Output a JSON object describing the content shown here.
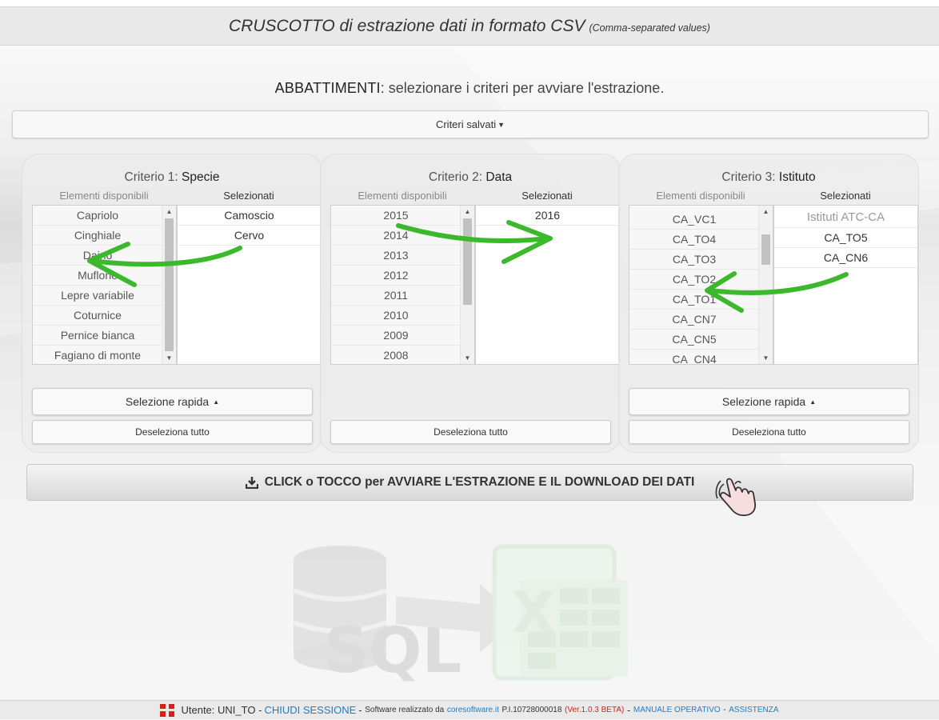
{
  "header": {
    "title": "CRUSCOTTO di estrazione dati in formato CSV",
    "subtitle": "(Comma-separated values)"
  },
  "section": {
    "title_bold": "ABBATTIMENTI",
    "title_rest": ": selezionare i criteri per avviare l'estrazione."
  },
  "saved_criteria_label": "Criteri salvati",
  "criteria": [
    {
      "prefix": "Criterio 1: ",
      "name": "Specie",
      "available_label": "Elementi disponibili",
      "selected_label": "Selezionati",
      "available": [
        "Capriolo",
        "Cinghiale",
        "Daino",
        "Muflone",
        "Lepre variabile",
        "Coturnice",
        "Pernice bianca",
        "Fagiano di monte"
      ],
      "selected": [
        "Camoscio",
        "Cervo"
      ],
      "quick_select_label": "Selezione rapida",
      "deselect_label": "Deseleziona tutto"
    },
    {
      "prefix": "Criterio 2: ",
      "name": "Data",
      "available_label": "Elementi disponibili",
      "selected_label": "Selezionati",
      "available": [
        "2015",
        "2014",
        "2013",
        "2012",
        "2011",
        "2010",
        "2009",
        "2008"
      ],
      "selected": [
        "2016"
      ],
      "deselect_label": "Deseleziona tutto"
    },
    {
      "prefix": "Criterio 3: ",
      "name": "Istituto",
      "available_label": "Elementi disponibili",
      "selected_label": "Selezionati",
      "available": [
        "CA_VC1",
        "CA_TO4",
        "CA_TO3",
        "CA_TO2",
        "CA_TO1",
        "CA_CN7",
        "CA_CN5",
        "CA_CN4"
      ],
      "selected_group": "Istituti ATC-CA",
      "selected": [
        "CA_TO5",
        "CA_CN6"
      ],
      "quick_select_label": "Selezione rapida",
      "deselect_label": "Deseleziona tutto"
    }
  ],
  "extract_button_label": "CLICK o TOCCO per AVVIARE L'ESTRAZIONE E IL DOWNLOAD DEI DATI",
  "footer": {
    "user_label": "Utente:",
    "user": "UNI_TO",
    "sep": "-",
    "close_session": "CHIUDI SESSIONE",
    "made_by": "Software realizzato da",
    "company": "coresoftware.it",
    "vat": "P.I.10728000018",
    "version": "(Ver.1.0.3 BETA)",
    "manual": "MANUALE OPERATIVO",
    "assistance": "ASSISTENZA"
  },
  "colors": {
    "link_blue": "#1e7ec8",
    "version_red": "#d9211b",
    "annotation_green": "#3cb82c"
  },
  "icons": {
    "download": "download-icon",
    "caret": "caret-down-icon",
    "hand": "hand-pointer-icon",
    "flag": "flag-icon",
    "background": "sql-to-excel-graphic"
  }
}
